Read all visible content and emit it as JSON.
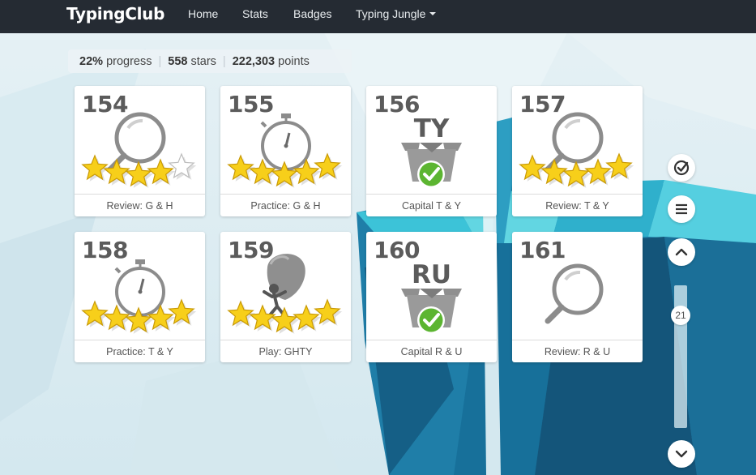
{
  "nav": {
    "brand": "TypingClub",
    "links": [
      "Home",
      "Stats",
      "Badges"
    ],
    "dropdown": "Typing Jungle"
  },
  "progress": {
    "percent": "22%",
    "percent_label": "progress",
    "stars": "558",
    "stars_label": "stars",
    "points": "222,303",
    "points_label": "points"
  },
  "lessons": [
    {
      "number": "154",
      "title": "Review: G & H",
      "kind": "review",
      "stars": 4
    },
    {
      "number": "155",
      "title": "Practice: G & H",
      "kind": "practice",
      "stars": 5
    },
    {
      "number": "156",
      "title": "Capital T & Y",
      "kind": "capital",
      "letters": "TY",
      "completed": true
    },
    {
      "number": "157",
      "title": "Review: T & Y",
      "kind": "review",
      "stars": 5
    },
    {
      "number": "158",
      "title": "Practice: T & Y",
      "kind": "practice",
      "stars": 5
    },
    {
      "number": "159",
      "title": "Play: GHTY",
      "kind": "play",
      "stars": 5
    },
    {
      "number": "160",
      "title": "Capital R & U",
      "kind": "capital",
      "letters": "RU",
      "completed": true
    },
    {
      "number": "161",
      "title": "Review: R & U",
      "kind": "review",
      "stars": 0
    }
  ],
  "scroll": {
    "position": "21"
  },
  "colors": {
    "navbar": "#252b33",
    "star": "#f7cf1a",
    "check": "#5cb531",
    "icon_gray": "#8c8c8c"
  }
}
